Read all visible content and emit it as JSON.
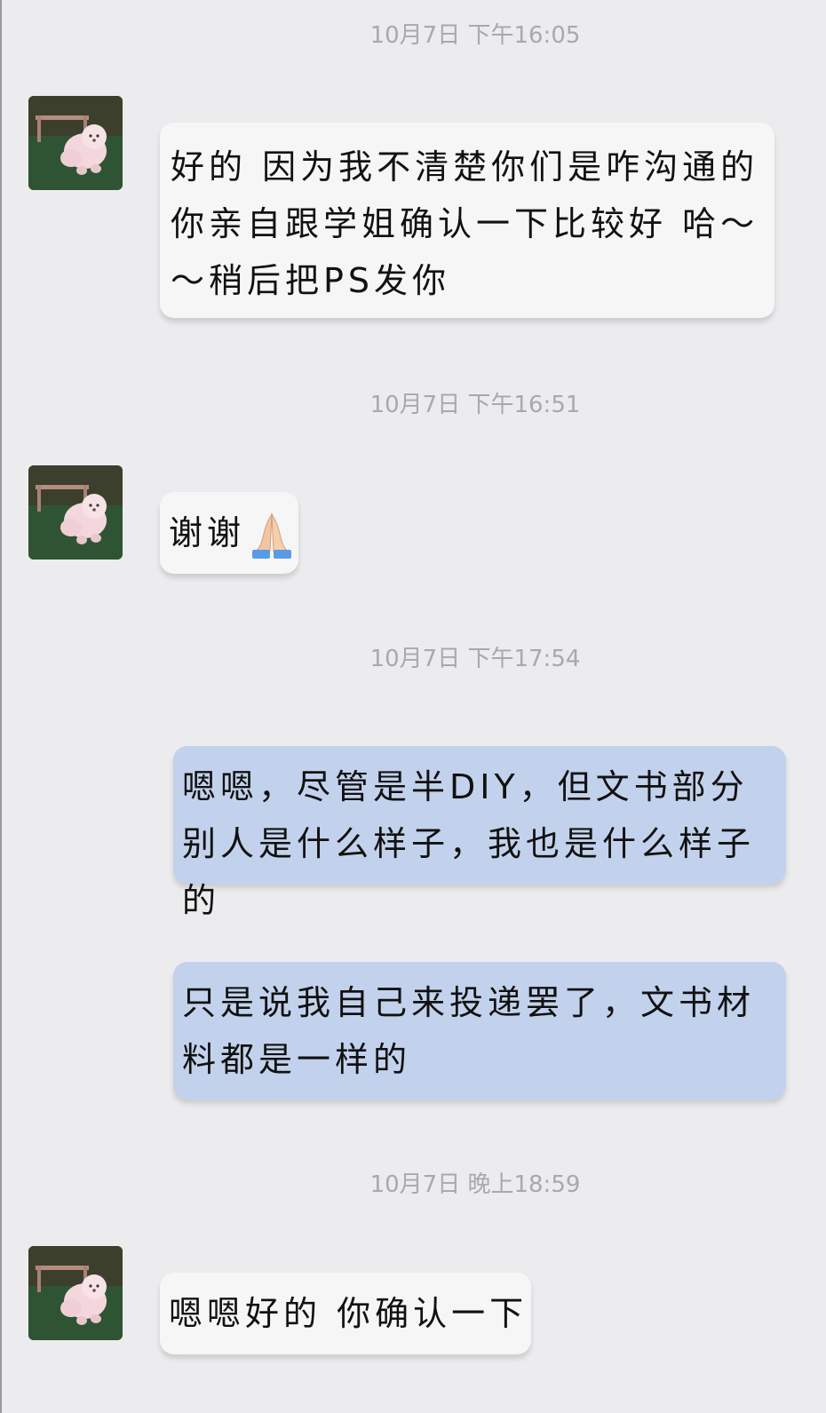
{
  "chat": {
    "messages": [
      {
        "type": "timestamp",
        "text": "10月7日 下午16:05"
      },
      {
        "type": "incoming",
        "avatar_icon": "dog-photo-avatar",
        "text": "好的 因为我不清楚你们是咋沟通的 你亲自跟学姐确认一下比较好 哈～～稍后把PS发你"
      },
      {
        "type": "timestamp",
        "text": "10月7日 下午16:51"
      },
      {
        "type": "incoming",
        "avatar_icon": "dog-photo-avatar",
        "text": "谢谢",
        "emoji": "folded-hands-emoji"
      },
      {
        "type": "timestamp",
        "text": "10月7日 下午17:54"
      },
      {
        "type": "outgoing",
        "text": "嗯嗯，尽管是半DIY，但文书部分别人是什么样子，我也是什么样子的"
      },
      {
        "type": "outgoing",
        "text": "只是说我自己来投递罢了，文书材料都是一样的"
      },
      {
        "type": "timestamp",
        "text": "10月7日 晚上18:59"
      },
      {
        "type": "incoming",
        "avatar_icon": "dog-photo-avatar",
        "text": "嗯嗯好的 你确认一下"
      }
    ]
  },
  "colors": {
    "background": "#ececee",
    "incoming_bubble": "#f6f6f7",
    "outgoing_bubble": "#c3d2ec",
    "timestamp_text": "#a9a9ad"
  }
}
